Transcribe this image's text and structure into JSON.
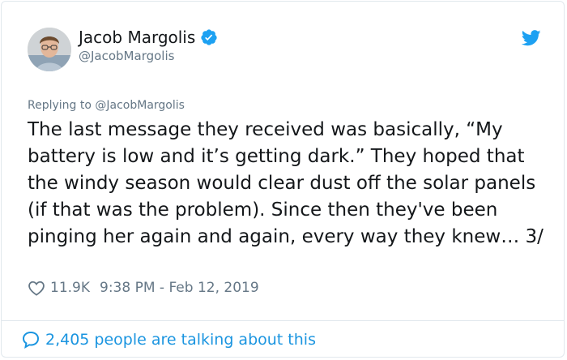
{
  "author": {
    "name": "Jacob Margolis",
    "handle": "@JacobMargolis"
  },
  "icons": {
    "avatar": "profile-photo",
    "verified": "verified-badge-icon",
    "brand": "twitter-bird-icon",
    "like": "heart-icon",
    "conversation": "chat-bubble-icon"
  },
  "colors": {
    "accent": "#1b95e0",
    "verified": "#1da1f2",
    "muted": "#657786",
    "text": "#14171a"
  },
  "reply": {
    "prefix": "Replying to",
    "handle": "@JacobMargolis"
  },
  "tweet": {
    "text": "The last message they received was basically, “My battery is low and it’s getting dark.” They hoped that the windy season would clear dust off the solar panels (if that was the problem). Since then they've been pinging her again and again, every way they knew… 3/",
    "likes": "11.9K",
    "timestamp": "9:38 PM - Feb 12, 2019"
  },
  "footer": {
    "talking": "2,405 people are talking about this"
  }
}
